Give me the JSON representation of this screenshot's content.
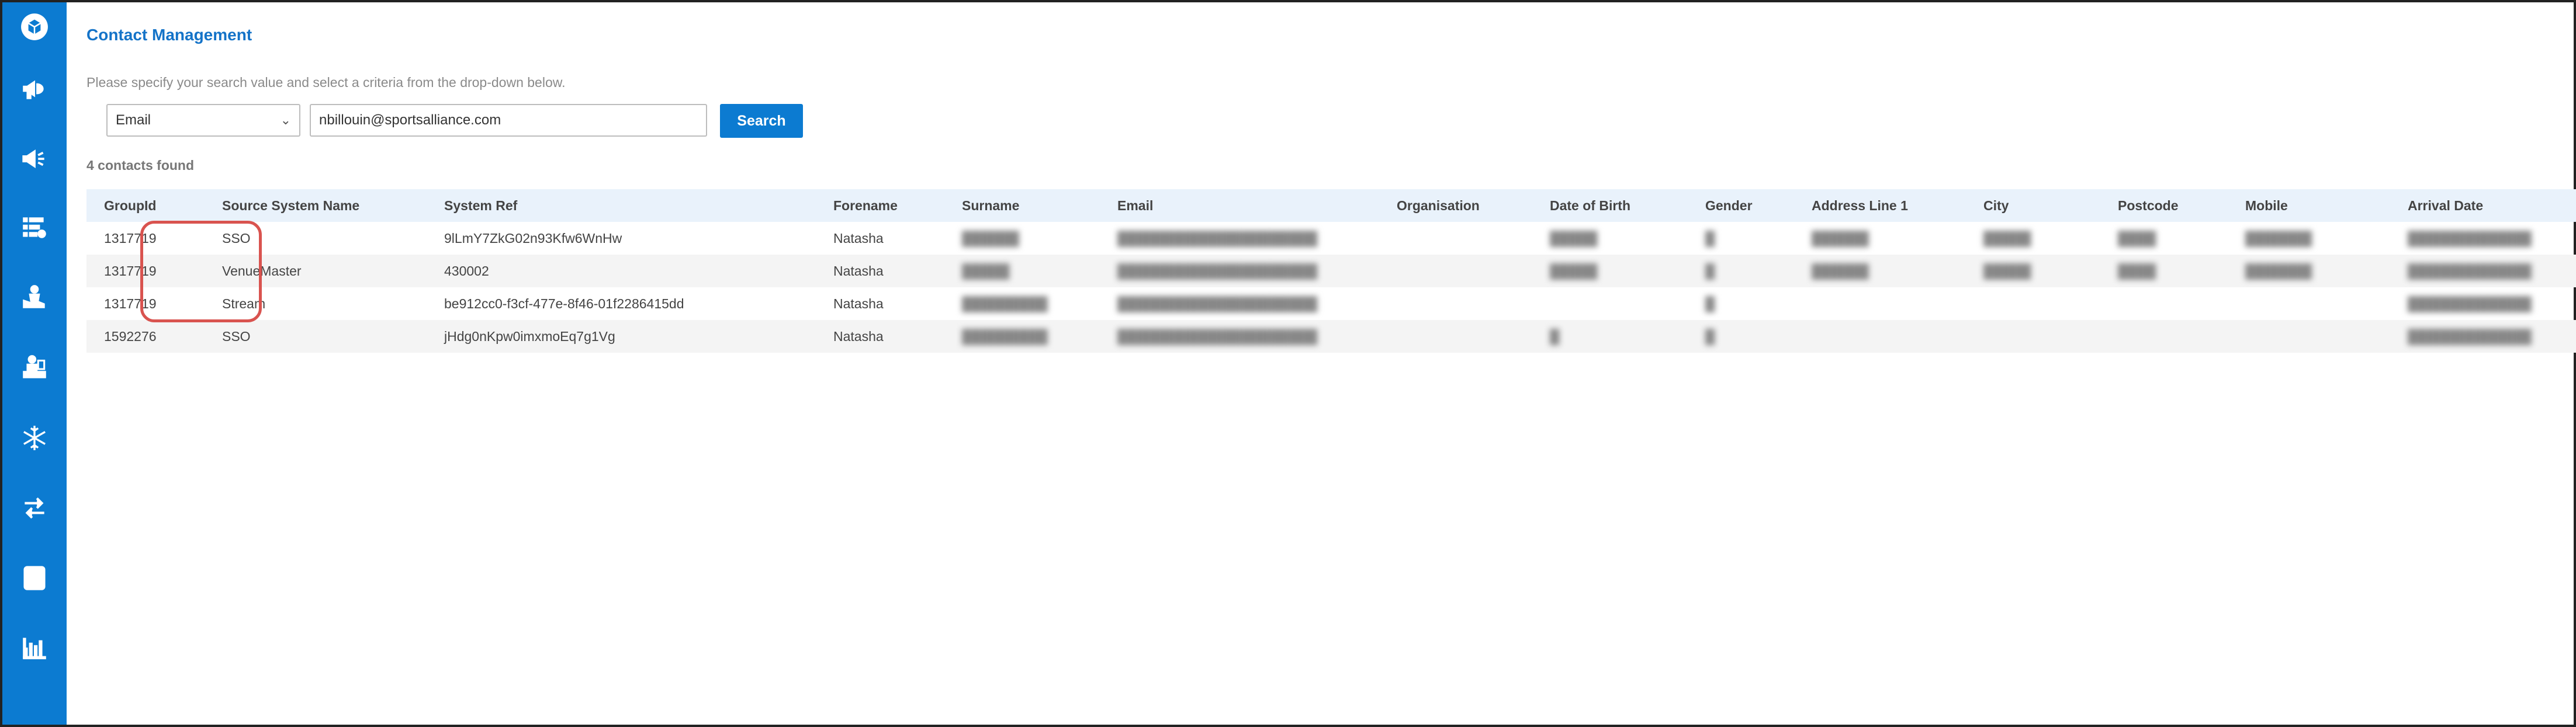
{
  "app": {
    "title": "Contact Management",
    "instructions": "Please specify your search value and select a criteria from the drop-down below."
  },
  "sidebar": {
    "items": [
      {
        "name": "logo",
        "icon": "cube-logo-icon"
      },
      {
        "name": "campaigns",
        "icon": "megaphone-icon"
      },
      {
        "name": "campaigns-outline",
        "icon": "megaphone-outline-icon"
      },
      {
        "name": "tasks",
        "icon": "checklist-icon"
      },
      {
        "name": "support",
        "icon": "hand-person-icon"
      },
      {
        "name": "presenter",
        "icon": "presenter-icon"
      },
      {
        "name": "snowflake",
        "icon": "snowflake-icon"
      },
      {
        "name": "transfer",
        "icon": "transfer-arrows-icon"
      },
      {
        "name": "contacts",
        "icon": "contact-card-icon"
      },
      {
        "name": "reports",
        "icon": "bar-chart-icon"
      }
    ]
  },
  "search": {
    "criteria_selected": "Email",
    "value": "nbillouin@sportsalliance.com",
    "button_label": "Search"
  },
  "results": {
    "count_label": "4 contacts found"
  },
  "table": {
    "columns": [
      "GroupId",
      "Source System Name",
      "System Ref",
      "Forename",
      "Surname",
      "Email",
      "Organisation",
      "Date of Birth",
      "Gender",
      "Address Line 1",
      "City",
      "Postcode",
      "Mobile",
      "Arrival Date"
    ],
    "rows": [
      {
        "group_id": "1317719",
        "source": "SSO",
        "system_ref": "9lLmY7ZkG02n93Kfw6WnHw",
        "forename": "Natasha"
      },
      {
        "group_id": "1317719",
        "source": "VenueMaster",
        "system_ref": "430002",
        "forename": "Natasha"
      },
      {
        "group_id": "1317719",
        "source": "Stream",
        "system_ref": "be912cc0-f3cf-477e-8f46-01f2286415dd",
        "forename": "Natasha"
      },
      {
        "group_id": "1592276",
        "source": "SSO",
        "system_ref": "jHdg0nKpw0imxmoEq7g1Vg",
        "forename": "Natasha"
      }
    ]
  },
  "colors": {
    "brand": "#0c7bd1",
    "highlight": "#d9534f"
  }
}
